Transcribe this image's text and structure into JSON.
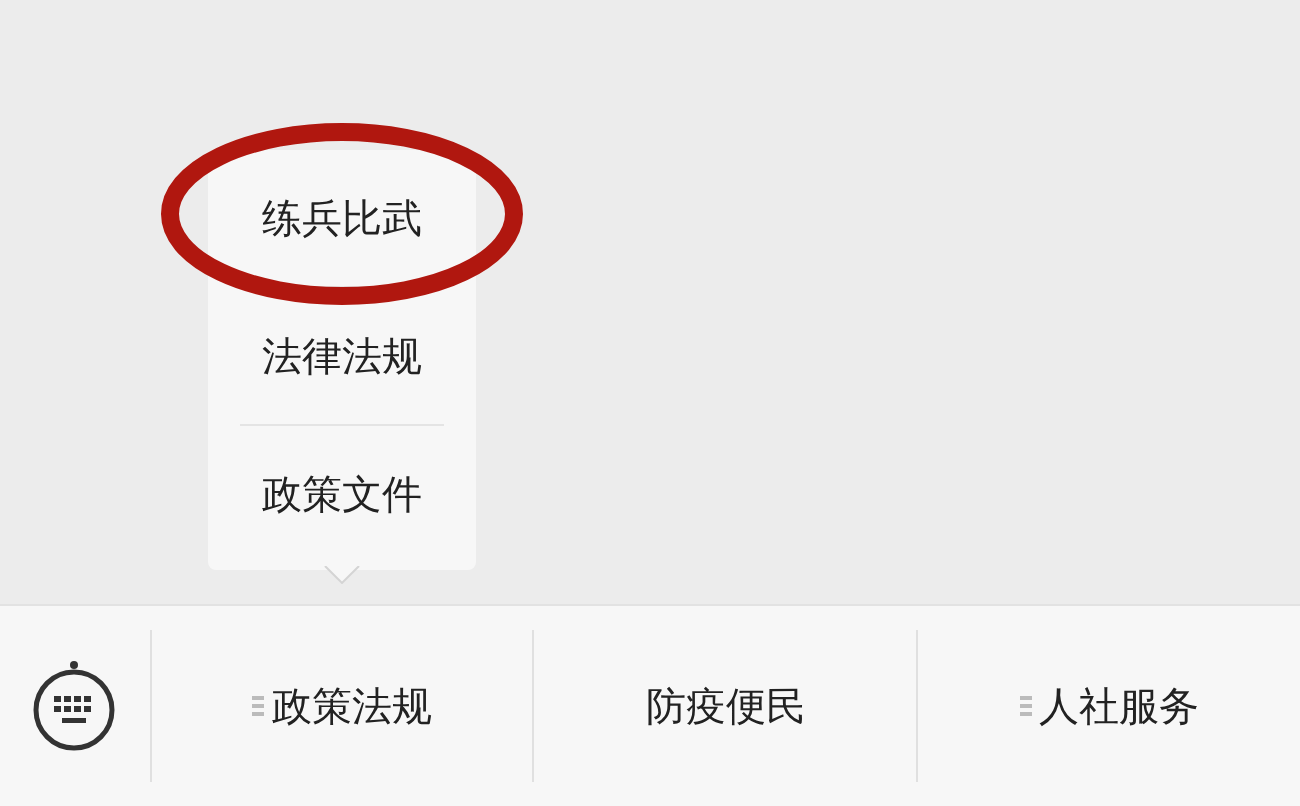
{
  "submenu": {
    "items": [
      {
        "label": "练兵比武",
        "circled": true
      },
      {
        "label": "法律法规",
        "circled": false
      },
      {
        "label": "政策文件",
        "circled": false
      }
    ]
  },
  "menu_bar": {
    "items": [
      {
        "label": "政策法规",
        "has_submenu": true,
        "expanded": true
      },
      {
        "label": "防疫便民",
        "has_submenu": false
      },
      {
        "label": "人社服务",
        "has_submenu": true,
        "expanded": false
      }
    ]
  }
}
